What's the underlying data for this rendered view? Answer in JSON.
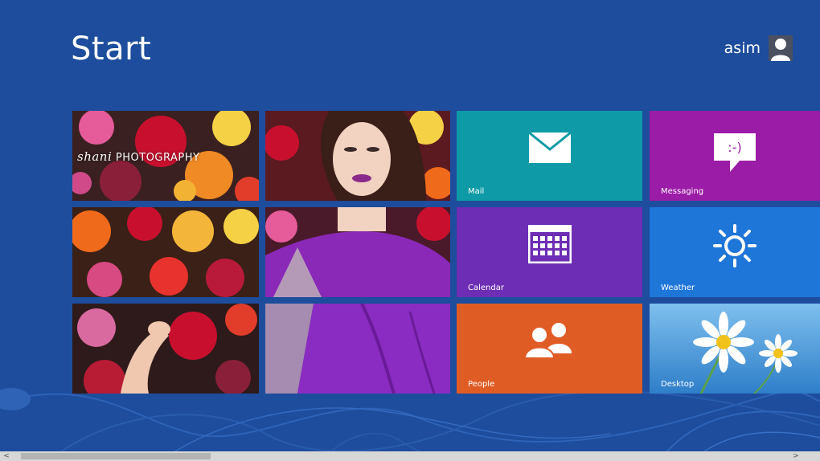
{
  "screen": {
    "title": "Start"
  },
  "user": {
    "name": "asim",
    "avatar_icon": "user-silhouette-icon"
  },
  "photo_tile": {
    "watermark_script": "shani",
    "watermark_text": "PHOTOGRAPHY"
  },
  "tiles": [
    {
      "id": "mail",
      "label": "Mail",
      "icon": "envelope-icon",
      "color": "#0e9aa7"
    },
    {
      "id": "messaging",
      "label": "Messaging",
      "icon": "speech-bubble-icon",
      "color": "#9b1ca6"
    },
    {
      "id": "calendar",
      "label": "Calendar",
      "icon": "calendar-icon",
      "color": "#6e2db5"
    },
    {
      "id": "weather",
      "label": "Weather",
      "icon": "sun-icon",
      "color": "#1f76d9"
    },
    {
      "id": "people",
      "label": "People",
      "icon": "people-icon",
      "color": "#e05c25"
    },
    {
      "id": "desktop",
      "label": "Desktop",
      "icon": "daisy-wallpaper",
      "color": "#3b8fd6"
    }
  ],
  "messaging_glyph": ":-)",
  "scrollbar": {
    "left_arrow": "<",
    "right_arrow": ">"
  },
  "colors": {
    "background": "#1d4d9c",
    "scrollbar": "#d7d7d7"
  }
}
